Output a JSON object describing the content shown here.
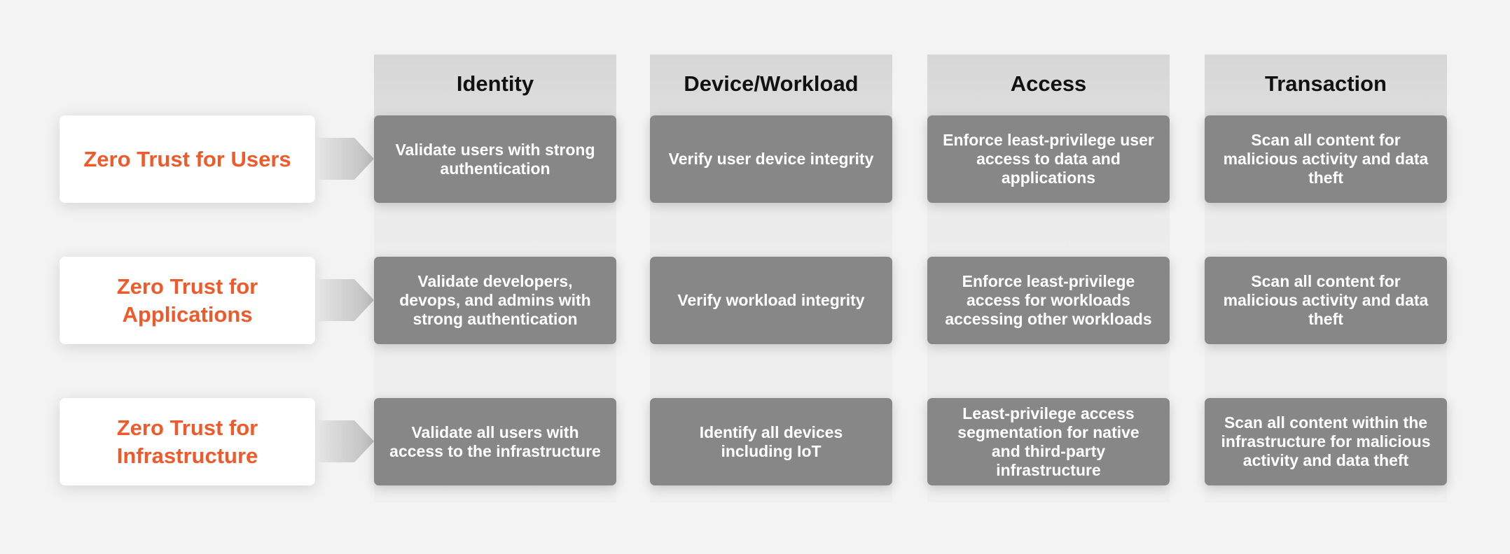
{
  "colors": {
    "accent": "#f05a2a",
    "card": "#878787",
    "header": "#d6d6d6",
    "background": "#f3f3f3"
  },
  "columns": [
    "Identity",
    "Device/Workload",
    "Access",
    "Transaction"
  ],
  "rows": [
    {
      "label": "Zero Trust for Users",
      "cells": [
        "Validate users with strong authentication",
        "Verify user device integrity",
        "Enforce least-privilege user access to data and applications",
        "Scan all content for malicious activity and data theft"
      ]
    },
    {
      "label": "Zero Trust for Applications",
      "cells": [
        "Validate developers, devops, and admins with strong authentication",
        "Verify workload integrity",
        "Enforce least-privilege access for workloads accessing other workloads",
        "Scan all content for malicious activity and data theft"
      ]
    },
    {
      "label": "Zero Trust for Infrastructure",
      "cells": [
        "Validate all users with access to the infrastructure",
        "Identify all devices including IoT",
        "Least-privilege access segmentation for native and third-party infrastructure",
        "Scan all content within the infrastructure for malicious activity and data theft"
      ]
    }
  ]
}
